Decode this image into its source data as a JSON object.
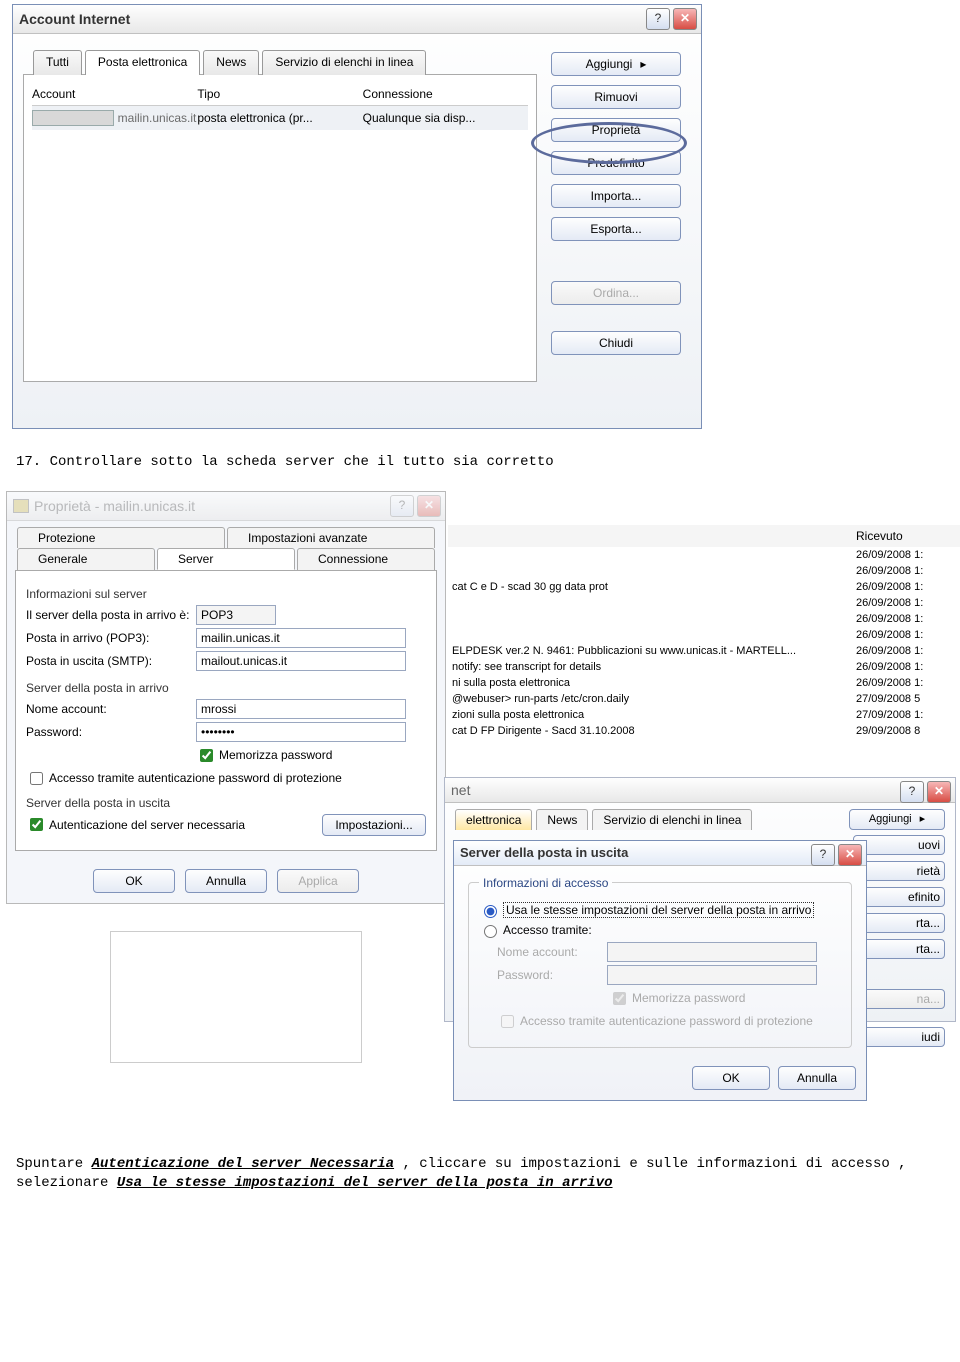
{
  "dialog1": {
    "title": "Account Internet",
    "tabs": [
      "Tutti",
      "Posta elettronica",
      "News",
      "Servizio di elenchi in linea"
    ],
    "active_tab": 1,
    "columns": {
      "account": "Account",
      "tipo": "Tipo",
      "conn": "Connessione"
    },
    "row": {
      "account": "mailin.unicas.it",
      "tipo": "posta elettronica (pr...",
      "conn": "Qualunque sia disp..."
    },
    "buttons": {
      "add": "Aggiungi",
      "remove": "Rimuovi",
      "properties": "Proprietà",
      "default": "Predefinito",
      "import": "Importa...",
      "export": "Esporta...",
      "sort": "Ordina...",
      "close": "Chiudi"
    }
  },
  "step17": "17. Controllare sotto la scheda server che il tutto sia corretto",
  "props": {
    "title": "Proprietà - mailin.unicas.it",
    "tabs_row1": [
      "Protezione",
      "Impostazioni avanzate"
    ],
    "tabs_row2": [
      "Generale",
      "Server",
      "Connessione"
    ],
    "info_group": "Informazioni sul server",
    "labels": {
      "servertype": "Il server della posta in arrivo è:",
      "pop3": "Posta in arrivo (POP3):",
      "smtp": "Posta in uscita (SMTP):",
      "incoming_group": "Server della posta in arrivo",
      "accountname": "Nome account:",
      "password": "Password:",
      "memorize": "Memorizza password",
      "secure_auth": "Accesso tramite autenticazione password di protezione",
      "outgoing_group": "Server della posta in uscita",
      "auth_required": "Autenticazione del server necessaria",
      "settings_btn": "Impostazioni..."
    },
    "values": {
      "servertype": "POP3",
      "pop3": "mailin.unicas.it",
      "smtp": "mailout.unicas.it",
      "account": "mrossi",
      "password": "••••••••"
    },
    "buttons": {
      "ok": "OK",
      "cancel": "Annulla",
      "apply": "Applica"
    }
  },
  "emails": {
    "header": "Ricevuto",
    "rows": [
      {
        "subj": "",
        "date": "26/09/2008 1:"
      },
      {
        "subj": "",
        "date": "26/09/2008 1:"
      },
      {
        "subj": "cat C e D - scad 30 gg data prot",
        "date": "26/09/2008 1:"
      },
      {
        "subj": "",
        "date": "26/09/2008 1:"
      },
      {
        "subj": "",
        "date": "26/09/2008 1:"
      },
      {
        "subj": "",
        "date": "26/09/2008 1:"
      },
      {
        "subj": "ELPDESK ver.2 N. 9461: Pubblicazioni su www.unicas.it - MARTELL...",
        "date": "26/09/2008 1:"
      },
      {
        "subj": "notify: see transcript for details",
        "date": "26/09/2008 1:"
      },
      {
        "subj": "ni sulla posta elettronica",
        "date": "26/09/2008 1:"
      },
      {
        "subj": "@webuser> run-parts /etc/cron.daily",
        "date": "27/09/2008 5"
      },
      {
        "subj": "zioni sulla posta elettronica",
        "date": "27/09/2008 1:"
      },
      {
        "subj": "cat D FP Dirigente - Sacd 31.10.2008",
        "date": "29/09/2008 8"
      }
    ]
  },
  "second_accounts": {
    "title_suffix": "net",
    "tabs": [
      "elettronica",
      "News",
      "Servizio di elenchi in linea"
    ],
    "buttons": {
      "add": "Aggiungi",
      "remove": "uovi",
      "props": "rietà",
      "default": "efinito",
      "import": "rta...",
      "export": "rta...",
      "sort": "na...",
      "close": "iudi"
    }
  },
  "outgoing": {
    "title": "Server della posta in uscita",
    "group": "Informazioni di accesso",
    "opt_same": "Usa le stesse impostazioni del server della posta in arrivo",
    "opt_access": "Accesso tramite:",
    "account_label": "Nome account:",
    "password_label": "Password:",
    "memorize": "Memorizza password",
    "secure": "Accesso tramite autenticazione password di protezione",
    "ok": "OK",
    "cancel": "Annulla"
  },
  "footer": {
    "line1_pre": "Spuntare ",
    "line1_bold": "Autenticazione del server Necessaria",
    "line1_mid": " , cliccare su impostazioni e sulle informazioni di accesso , selezionare ",
    "line1_bold2": "Usa le stesse impostazioni del server della posta in arrivo"
  }
}
